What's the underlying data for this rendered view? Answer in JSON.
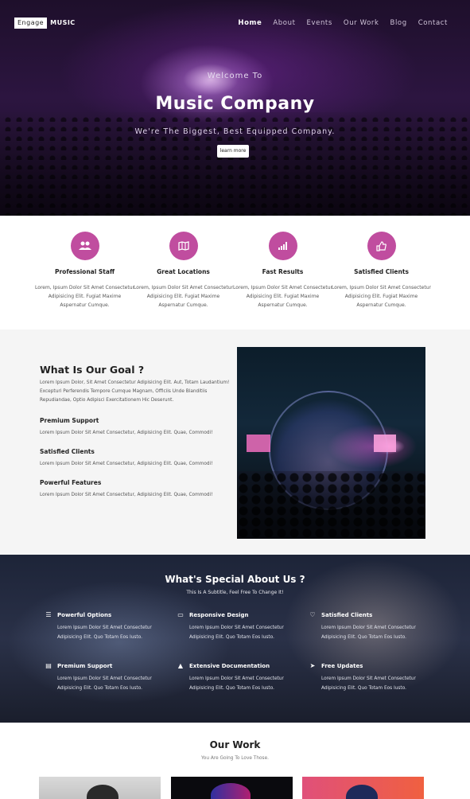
{
  "header": {
    "logo_box": "Engage",
    "logo_text": "MUSIC",
    "nav": [
      "Home",
      "About",
      "Events",
      "Our Work",
      "Blog",
      "Contact"
    ]
  },
  "hero": {
    "welcome": "Welcome To",
    "title": "Music Company",
    "tagline": "We're The Biggest, Best Equipped Company.",
    "button": "learn more"
  },
  "features": [
    {
      "icon": "group-icon",
      "title": "Professional Staff",
      "desc": "Lorem, Ipsum Dolor Sit Amet Consectetur Adipisicing Elit. Fugiat Maxime Aspernatur Cumque."
    },
    {
      "icon": "map-icon",
      "title": "Great Locations",
      "desc": "Lorem, Ipsum Dolor Sit Amet Consectetur Adipisicing Elit. Fugiat Maxime Aspernatur Cumque."
    },
    {
      "icon": "bar-chart-icon",
      "title": "Fast Results",
      "desc": "Lorem, Ipsum Dolor Sit Amet Consectetur Adipisicing Elit. Fugiat Maxime Aspernatur Cumque."
    },
    {
      "icon": "thumbs-up-icon",
      "title": "Satisfied Clients",
      "desc": "Lorem, Ipsum Dolor Sit Amet Consectetur Adipisicing Elit. Fugiat Maxime Aspernatur Cumque."
    }
  ],
  "goal": {
    "title": "What Is Our Goal ?",
    "intro": "Lorem Ipsum Dolor, Sit Amet Consectetur Adipisicing Elit. Aut, Totam Laudantium! Excepturi Perferendis Tempore Cumque Magnam, Officiis Unde Blanditiis Repudiandae, Optio Adipisci Exercitationem Hic Deserunt.",
    "items": [
      {
        "title": "Premium Support",
        "desc": "Lorem Ipsum Dolor Sit Amet Consectetur, Adipisicing Elit. Quae, Commodi!"
      },
      {
        "title": "Satisfied Clients",
        "desc": "Lorem Ipsum Dolor Sit Amet Consectetur, Adipisicing Elit. Quae, Commodi!"
      },
      {
        "title": "Powerful Features",
        "desc": "Lorem Ipsum Dolor Sit Amet Consectetur, Adipisicing Elit. Quae, Commodi!"
      }
    ]
  },
  "special": {
    "title": "What's Special About Us ?",
    "subtitle": "This Is A Subtitle, Feel Free To Change It!",
    "items": [
      {
        "icon": "sliders-icon",
        "title": "Powerful Options",
        "desc": "Lorem Ipsum Dolor Sit Amet Consectetur Adipisicing Elit. Quo Totam Eos Iusto."
      },
      {
        "icon": "monitor-icon",
        "title": "Responsive Design",
        "desc": "Lorem Ipsum Dolor Sit Amet Consectetur Adipisicing Elit. Quo Totam Eos Iusto."
      },
      {
        "icon": "heart-icon",
        "title": "Satisfied Clients",
        "desc": "Lorem Ipsum Dolor Sit Amet Consectetur Adipisicing Elit. Quo Totam Eos Iusto."
      },
      {
        "icon": "id-card-icon",
        "title": "Premium Support",
        "desc": "Lorem Ipsum Dolor Sit Amet Consectetur Adipisicing Elit. Quo Totam Eos Iusto."
      },
      {
        "icon": "graduation-cap-icon",
        "title": "Extensive Documentation",
        "desc": "Lorem Ipsum Dolor Sit Amet Consectetur Adipisicing Elit. Quo Totam Eos Iusto."
      },
      {
        "icon": "paper-plane-icon",
        "title": "Free Updates",
        "desc": "Lorem Ipsum Dolor Sit Amet Consectetur Adipisicing Elit. Quo Totam Eos Iusto."
      }
    ]
  },
  "work": {
    "title": "Our Work",
    "subtitle": "You Are Going To Love Those."
  },
  "colors": {
    "accent": "#c04d9f",
    "hero_bg": "#2c1540"
  }
}
